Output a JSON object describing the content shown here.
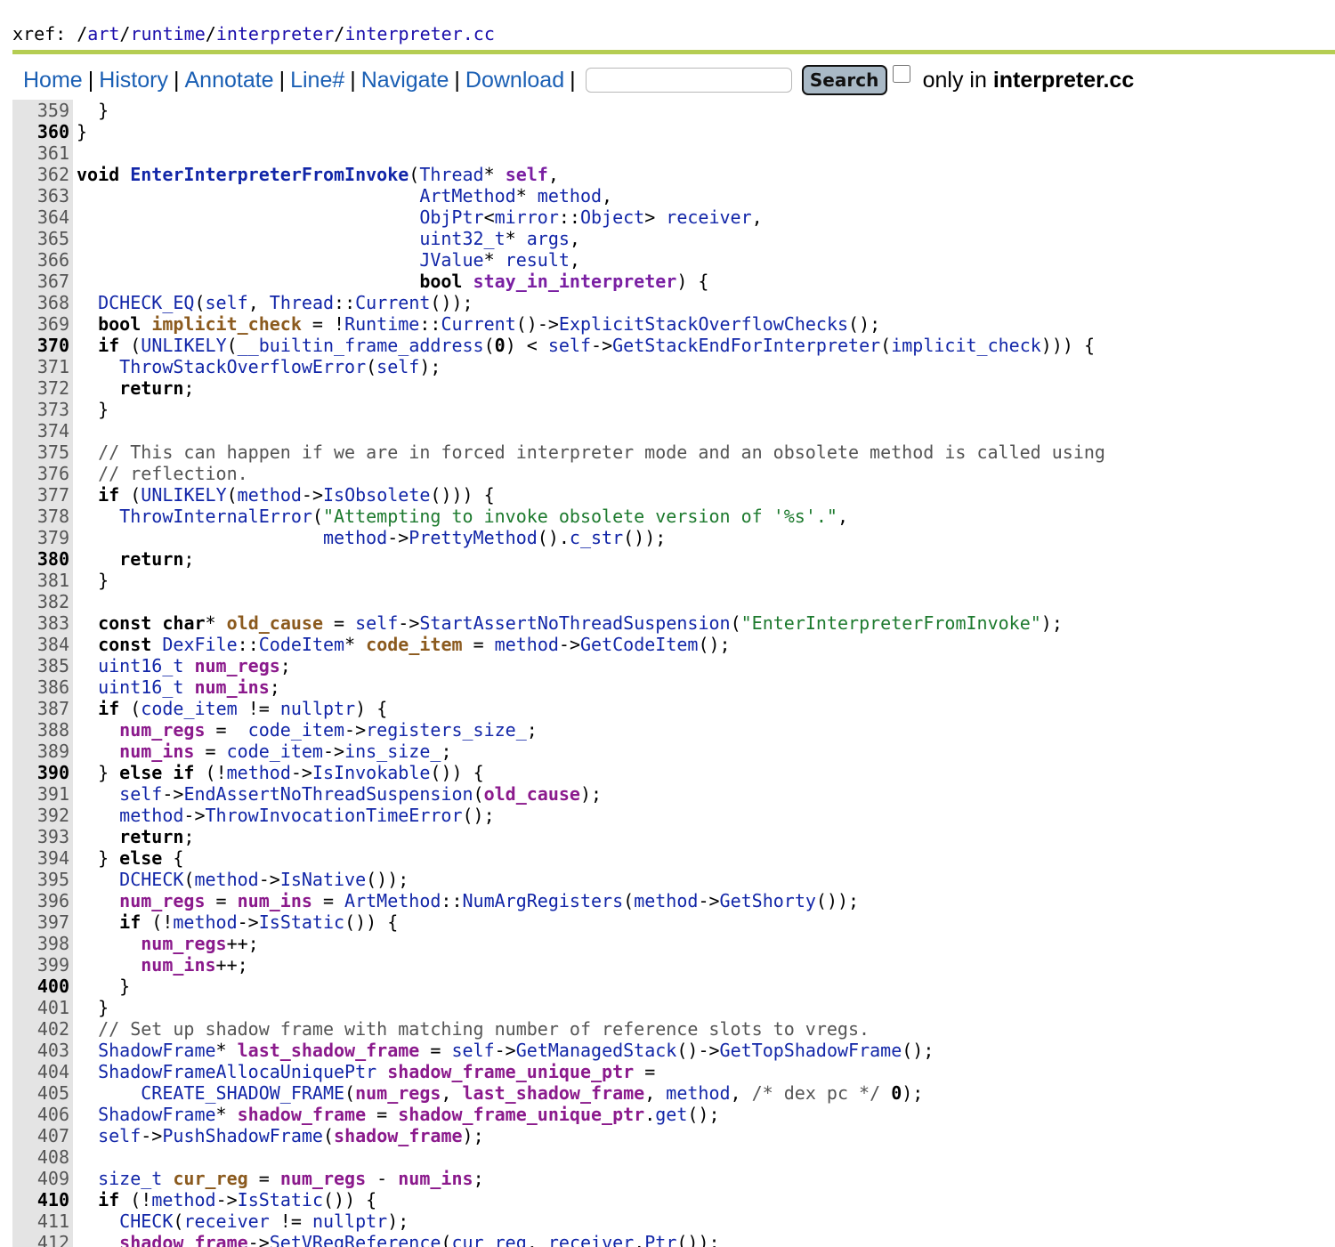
{
  "xref": {
    "prefix": "xref: /",
    "path": [
      {
        "text": "art",
        "sep": "/"
      },
      {
        "text": "runtime",
        "sep": "/"
      },
      {
        "text": "interpreter",
        "sep": "/"
      },
      {
        "text": "interpreter.cc",
        "sep": ""
      }
    ]
  },
  "toolbar": {
    "nav": [
      "Home",
      "History",
      "Annotate",
      "Line#",
      "Navigate",
      "Download"
    ],
    "search_value": "",
    "search_label": "Search",
    "only_in_prefix": "only in ",
    "only_in_file": "interpreter.cc"
  },
  "colors": {
    "rule": "#b5cd52",
    "link": "#1a5fb4",
    "function": "#1226a8",
    "local": "#8b5a1e",
    "string": "#1d7a2e"
  },
  "code": [
    {
      "n": 359,
      "s": "  }"
    },
    {
      "n": 360,
      "s": "}"
    },
    {
      "n": 361,
      "s": ""
    },
    {
      "n": 362,
      "s": "void EnterInterpreterFromInvoke(Thread* self,"
    },
    {
      "n": 363,
      "s": "                                ArtMethod* method,"
    },
    {
      "n": 364,
      "s": "                                ObjPtr<mirror::Object> receiver,"
    },
    {
      "n": 365,
      "s": "                                uint32_t* args,"
    },
    {
      "n": 366,
      "s": "                                JValue* result,"
    },
    {
      "n": 367,
      "s": "                                bool stay_in_interpreter) {"
    },
    {
      "n": 368,
      "s": "  DCHECK_EQ(self, Thread::Current());"
    },
    {
      "n": 369,
      "s": "  bool implicit_check = !Runtime::Current()->ExplicitStackOverflowChecks();"
    },
    {
      "n": 370,
      "s": "  if (UNLIKELY(__builtin_frame_address(0) < self->GetStackEndForInterpreter(implicit_check))) {"
    },
    {
      "n": 371,
      "s": "    ThrowStackOverflowError(self);"
    },
    {
      "n": 372,
      "s": "    return;"
    },
    {
      "n": 373,
      "s": "  }"
    },
    {
      "n": 374,
      "s": ""
    },
    {
      "n": 375,
      "s": "  // This can happen if we are in forced interpreter mode and an obsolete method is called using"
    },
    {
      "n": 376,
      "s": "  // reflection."
    },
    {
      "n": 377,
      "s": "  if (UNLIKELY(method->IsObsolete())) {"
    },
    {
      "n": 378,
      "s": "    ThrowInternalError(\"Attempting to invoke obsolete version of '%s'.\","
    },
    {
      "n": 379,
      "s": "                       method->PrettyMethod().c_str());"
    },
    {
      "n": 380,
      "s": "    return;"
    },
    {
      "n": 381,
      "s": "  }"
    },
    {
      "n": 382,
      "s": ""
    },
    {
      "n": 383,
      "s": "  const char* old_cause = self->StartAssertNoThreadSuspension(\"EnterInterpreterFromInvoke\");"
    },
    {
      "n": 384,
      "s": "  const DexFile::CodeItem* code_item = method->GetCodeItem();"
    },
    {
      "n": 385,
      "s": "  uint16_t num_regs;"
    },
    {
      "n": 386,
      "s": "  uint16_t num_ins;"
    },
    {
      "n": 387,
      "s": "  if (code_item != nullptr) {"
    },
    {
      "n": 388,
      "s": "    num_regs =  code_item->registers_size_;"
    },
    {
      "n": 389,
      "s": "    num_ins = code_item->ins_size_;"
    },
    {
      "n": 390,
      "s": "  } else if (!method->IsInvokable()) {"
    },
    {
      "n": 391,
      "s": "    self->EndAssertNoThreadSuspension(old_cause);"
    },
    {
      "n": 392,
      "s": "    method->ThrowInvocationTimeError();"
    },
    {
      "n": 393,
      "s": "    return;"
    },
    {
      "n": 394,
      "s": "  } else {"
    },
    {
      "n": 395,
      "s": "    DCHECK(method->IsNative());"
    },
    {
      "n": 396,
      "s": "    num_regs = num_ins = ArtMethod::NumArgRegisters(method->GetShorty());"
    },
    {
      "n": 397,
      "s": "    if (!method->IsStatic()) {"
    },
    {
      "n": 398,
      "s": "      num_regs++;"
    },
    {
      "n": 399,
      "s": "      num_ins++;"
    },
    {
      "n": 400,
      "s": "    }"
    },
    {
      "n": 401,
      "s": "  }"
    },
    {
      "n": 402,
      "s": "  // Set up shadow frame with matching number of reference slots to vregs."
    },
    {
      "n": 403,
      "s": "  ShadowFrame* last_shadow_frame = self->GetManagedStack()->GetTopShadowFrame();"
    },
    {
      "n": 404,
      "s": "  ShadowFrameAllocaUniquePtr shadow_frame_unique_ptr ="
    },
    {
      "n": 405,
      "s": "      CREATE_SHADOW_FRAME(num_regs, last_shadow_frame, method, /* dex pc */ 0);"
    },
    {
      "n": 406,
      "s": "  ShadowFrame* shadow_frame = shadow_frame_unique_ptr.get();"
    },
    {
      "n": 407,
      "s": "  self->PushShadowFrame(shadow_frame);"
    },
    {
      "n": 408,
      "s": ""
    },
    {
      "n": 409,
      "s": "  size_t cur_reg = num_regs - num_ins;"
    },
    {
      "n": 410,
      "s": "  if (!method->IsStatic()) {"
    },
    {
      "n": 411,
      "s": "    CHECK(receiver != nullptr);"
    },
    {
      "n": 412,
      "s": "    shadow_frame->SetVRegReference(cur_reg, receiver.Ptr());"
    }
  ]
}
